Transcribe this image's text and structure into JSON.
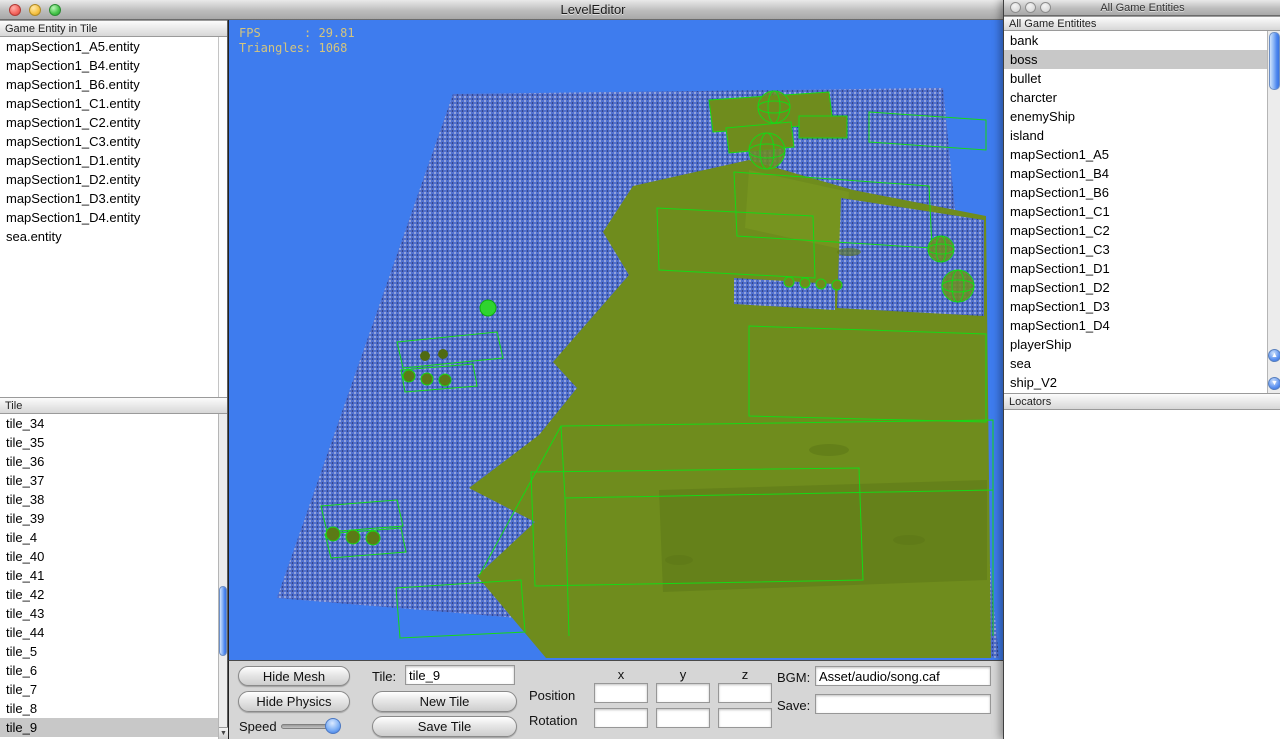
{
  "window": {
    "title": "LevelEditor"
  },
  "viewport": {
    "fps_line1": "FPS      : 29.81",
    "fps_line2": "Triangles: 1068"
  },
  "left": {
    "entity_header": "Game Entity in Tile",
    "entities": [
      "mapSection1_A5.entity",
      "mapSection1_B4.entity",
      "mapSection1_B6.entity",
      "mapSection1_C1.entity",
      "mapSection1_C2.entity",
      "mapSection1_C3.entity",
      "mapSection1_D1.entity",
      "mapSection1_D2.entity",
      "mapSection1_D3.entity",
      "mapSection1_D4.entity",
      "sea.entity"
    ],
    "tile_header": "Tile",
    "tiles": [
      "tile_34",
      "tile_35",
      "tile_36",
      "tile_37",
      "tile_38",
      "tile_39",
      "tile_4",
      "tile_40",
      "tile_41",
      "tile_42",
      "tile_43",
      "tile_44",
      "tile_5",
      "tile_6",
      "tile_7",
      "tile_8",
      "tile_9"
    ],
    "selected_tile": "tile_9"
  },
  "palette": {
    "window_title": "All Game Entities",
    "list_header": "All Game Entitites",
    "items": [
      "bank",
      "boss",
      "bullet",
      "charcter",
      "enemyShip",
      "island",
      "mapSection1_A5",
      "mapSection1_B4",
      "mapSection1_B6",
      "mapSection1_C1",
      "mapSection1_C2",
      "mapSection1_C3",
      "mapSection1_D1",
      "mapSection1_D2",
      "mapSection1_D3",
      "mapSection1_D4",
      "playerShip",
      "sea",
      "ship_V2"
    ],
    "selected": "boss",
    "locators_header": "Locators"
  },
  "controls": {
    "hide_mesh": "Hide Mesh",
    "hide_physics": "Hide Physics",
    "speed": "Speed",
    "tile_label": "Tile:",
    "tile_value": "tile_9",
    "new_tile": "New Tile",
    "save_tile": "Save Tile",
    "position": "Position",
    "rotation": "Rotation",
    "axes": [
      "x",
      "y",
      "z"
    ],
    "bgm_label": "BGM:",
    "bgm_value": "Asset/audio/song.caf",
    "save_label": "Save:",
    "save_value": ""
  }
}
